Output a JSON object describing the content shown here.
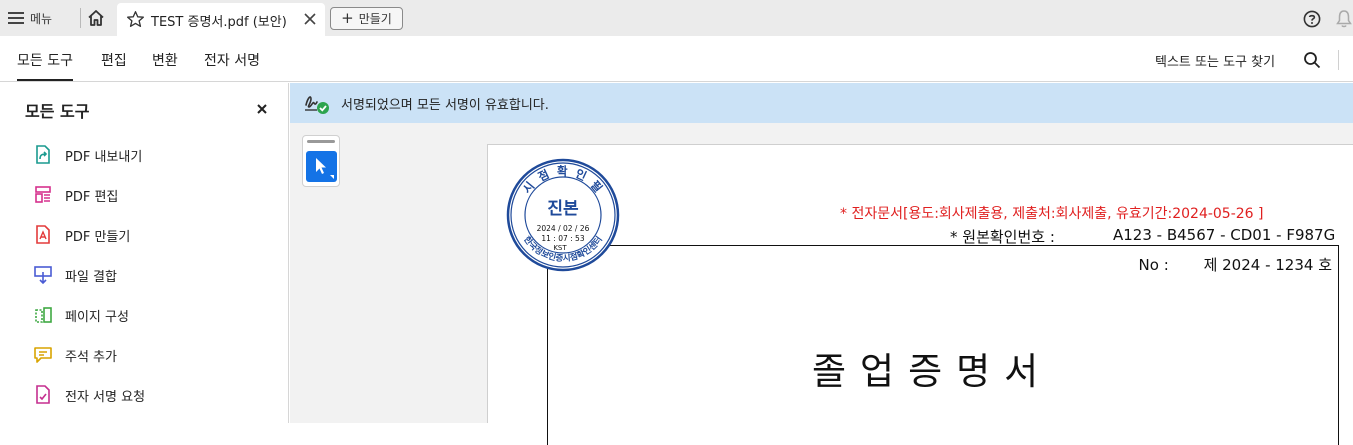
{
  "titlebar": {
    "menu_label": "메뉴",
    "tab_title": "TEST 증명서.pdf (보안)",
    "new_label": "만들기"
  },
  "toolbar": {
    "tabs": [
      "모든 도구",
      "편집",
      "변환",
      "전자 서명"
    ],
    "find_label": "텍스트 또는 도구 찾기"
  },
  "sidebar": {
    "title": "모든 도구",
    "items": [
      {
        "label": "PDF 내보내기",
        "icon": "export-pdf-icon",
        "color": "#1a9a8f"
      },
      {
        "label": "PDF 편집",
        "icon": "edit-pdf-icon",
        "color": "#d6318e"
      },
      {
        "label": "PDF 만들기",
        "icon": "create-pdf-icon",
        "color": "#e33b3b"
      },
      {
        "label": "파일 결합",
        "icon": "combine-files-icon",
        "color": "#4a5bd4"
      },
      {
        "label": "페이지 구성",
        "icon": "organize-pages-icon",
        "color": "#3fa843"
      },
      {
        "label": "주석 추가",
        "icon": "comment-icon",
        "color": "#d9a400"
      },
      {
        "label": "전자 서명 요청",
        "icon": "request-esign-icon",
        "color": "#c52f8f"
      }
    ]
  },
  "banner": {
    "text": "서명되었으며 모든 서명이 유효합니다."
  },
  "document": {
    "red_line": "* 전자문서[용도:회사제출용, 제출처:회사제출, 유효기간:2024-05-26 ]",
    "origin_label": "* 원본확인번호 :",
    "origin_number": "A123 - B4567 - CD01 - F987G",
    "no_label": "No :",
    "no_value": "제 2024 - 1234 호",
    "heading": "졸업증명서",
    "seal": {
      "top_arc": "시 점 확 인 필",
      "center": "진본",
      "date": "2024 / 02 / 26",
      "time": "11 : 07 : 53",
      "zone": "KST",
      "bottom_arc": "한국정보인증시점확인센터"
    }
  },
  "colors": {
    "accent": "#1473e6",
    "banner_bg": "#cbe2f6",
    "seal_blue": "#1f4a9a",
    "warning_red": "#e02020"
  }
}
